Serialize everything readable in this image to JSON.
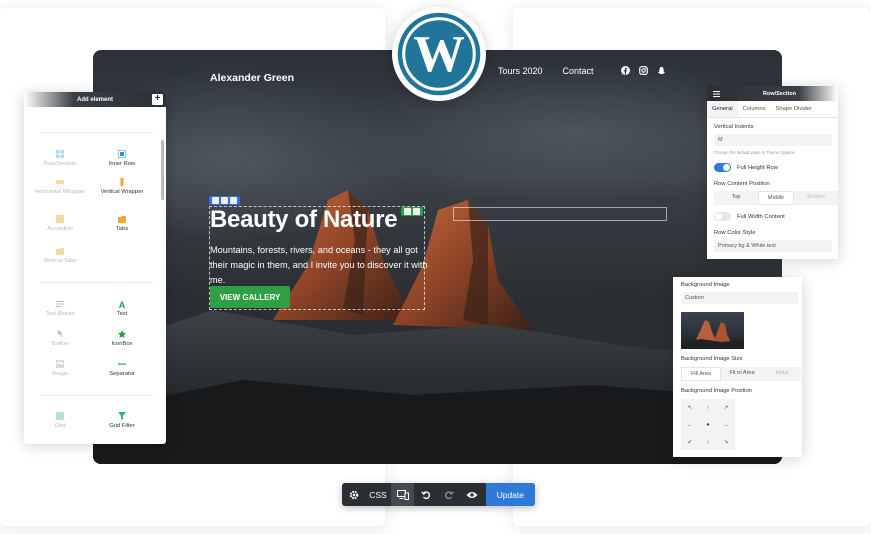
{
  "site": {
    "logo": "Alexander Green",
    "nav": [
      "Tours 2020",
      "Contact"
    ],
    "hero_title": "Beauty of Nature",
    "hero_text": "Mountains, forests, rivers, and oceans - they all got their magic in them, and I invite you to discover it with me.",
    "hero_button": "VIEW GALLERY"
  },
  "add_panel": {
    "title": "Add element",
    "items": [
      {
        "label": "Row/Section",
        "icon": "row-section-icon",
        "faded": true
      },
      {
        "label": "Inner Row",
        "icon": "inner-row-icon",
        "faded": false
      },
      {
        "label": "Horizontal Wrapper",
        "icon": "horizontal-wrapper-icon",
        "faded": true
      },
      {
        "label": "Vertical Wrapper",
        "icon": "vertical-wrapper-icon",
        "faded": false
      },
      {
        "label": "Accordion",
        "icon": "accordion-icon",
        "faded": true
      },
      {
        "label": "Tabs",
        "icon": "tabs-icon",
        "faded": false
      },
      {
        "label": "Vertical Tabs",
        "icon": "vertical-tabs-icon",
        "faded": true
      },
      {
        "label": "Text Blocks",
        "icon": "text-blocks-icon",
        "faded": true
      },
      {
        "label": "Text",
        "icon": "text-icon",
        "faded": false
      },
      {
        "label": "Button",
        "icon": "button-icon",
        "faded": true
      },
      {
        "label": "IconBox",
        "icon": "iconbox-icon",
        "faded": false
      },
      {
        "label": "Image",
        "icon": "image-icon",
        "faded": true
      },
      {
        "label": "Separator",
        "icon": "separator-icon",
        "faded": false
      },
      {
        "label": "Grid",
        "icon": "grid-icon",
        "faded": true
      },
      {
        "label": "Grid Filter",
        "icon": "grid-filter-icon",
        "faded": false
      }
    ]
  },
  "row_panel": {
    "title": "Row/Section",
    "tabs": [
      "General",
      "Columns",
      "Shape Divider"
    ],
    "vertical_indents_label": "Vertical Indents",
    "vertical_indents_value": "M",
    "hint": "Change the default value in Theme Options",
    "full_height_label": "Full Height Row",
    "content_position_label": "Row Content Position",
    "positions": [
      "Top",
      "Middle",
      "Bottom"
    ],
    "full_width_label": "Full Width Content",
    "color_style_label": "Row Color Style",
    "color_style_value": "Primary bg & White text"
  },
  "bg_panel": {
    "image_label": "Background Image",
    "image_value": "Custom",
    "size_label": "Background Image Size",
    "sizes": [
      "Fill Area",
      "Fit to Area",
      "Initial"
    ],
    "position_label": "Background Image Position",
    "arrows": [
      "↖",
      "↑",
      "↗",
      "←",
      "●",
      "→",
      "↙",
      "↓",
      "↘"
    ]
  },
  "toolbar": {
    "css": "CSS",
    "update": "Update"
  },
  "colors": {
    "accent_green": "#2ea043",
    "accent_blue": "#2f7ad8",
    "wordpress_blue": "#21759b",
    "dark": "#2b2f34"
  }
}
